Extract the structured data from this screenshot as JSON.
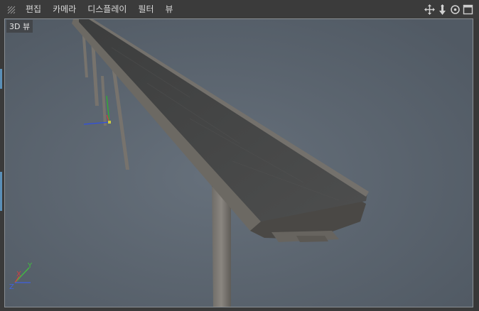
{
  "menu": {
    "items": [
      "편집",
      "카메라",
      "디스플레이",
      "필터",
      "뷰"
    ]
  },
  "nav_icons": [
    "move-icon",
    "zoom-icon",
    "rotate-icon",
    "maximize-icon"
  ],
  "viewport": {
    "label": "3D 뷰",
    "background_color": "#5b6571"
  },
  "axis_gizmo": {
    "x_label": "X",
    "y_label": "Y",
    "z_label": "Z",
    "colors": {
      "x": "#d04040",
      "y": "#40c040",
      "z": "#4060e0"
    }
  }
}
